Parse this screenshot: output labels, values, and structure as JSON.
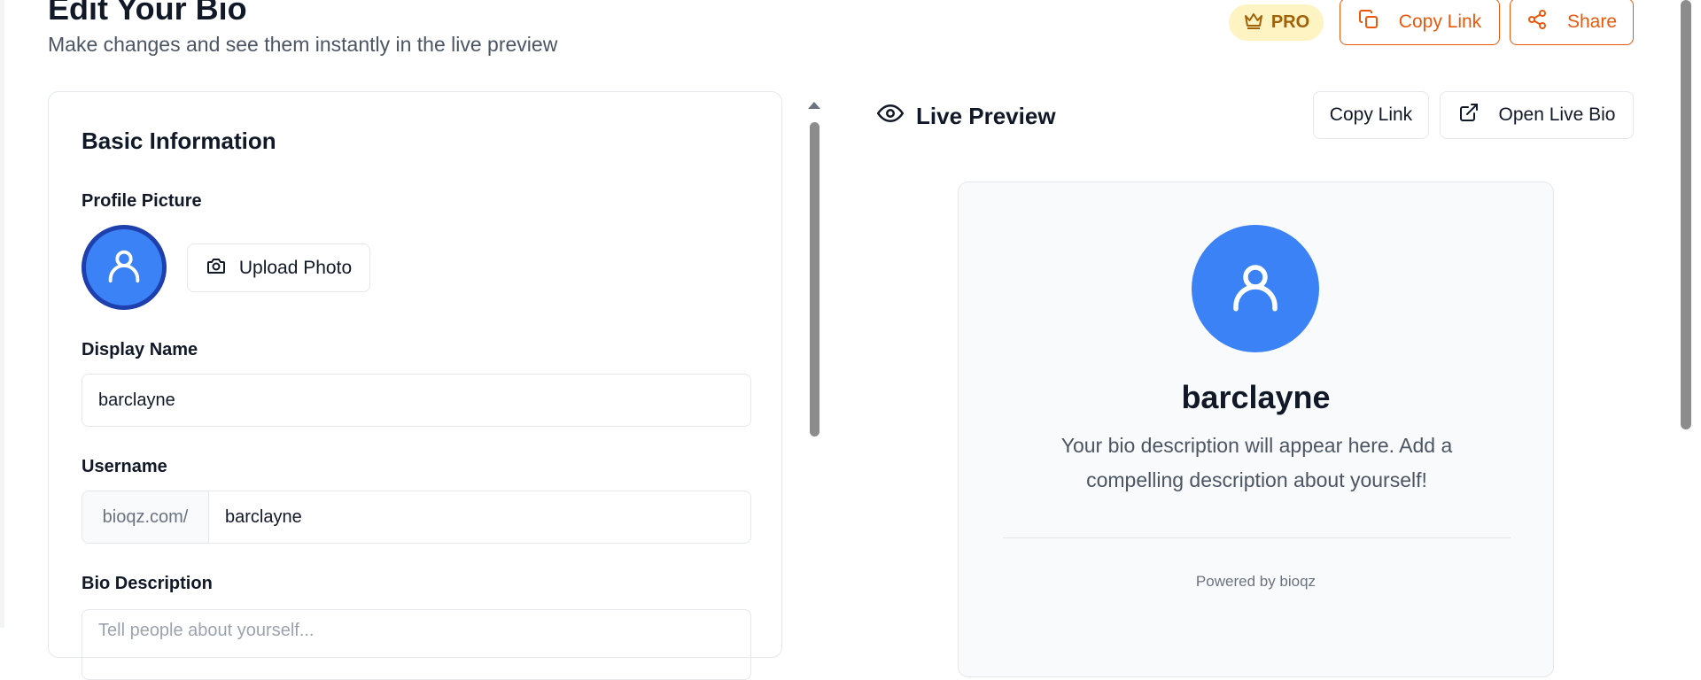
{
  "header": {
    "title": "Edit Your Bio",
    "subtitle": "Make changes and see them instantly in the live preview",
    "pro_label": "PRO",
    "copy_link_label": "Copy Link",
    "share_label": "Share"
  },
  "form": {
    "section_title": "Basic Information",
    "profile_picture_label": "Profile Picture",
    "upload_label": "Upload Photo",
    "display_name_label": "Display Name",
    "display_name_value": "barclayne",
    "username_label": "Username",
    "username_prefix": "bioqz.com/",
    "username_value": "barclayne",
    "bio_label": "Bio Description",
    "bio_placeholder": "Tell people about yourself..."
  },
  "preview": {
    "title": "Live Preview",
    "copy_link_label": "Copy Link",
    "open_live_label": "Open Live Bio",
    "name": "barclayne",
    "description": "Your bio description will appear here. Add a compelling description about yourself!",
    "powered_by": "Powered by bioqz"
  },
  "colors": {
    "accent": "#ea580c",
    "avatar": "#3b82f6",
    "pro_bg": "#fdf3c3",
    "pro_text": "#a16207"
  },
  "icons": [
    "crown-icon",
    "copy-icon",
    "share-icon",
    "user-icon",
    "camera-icon",
    "eye-icon",
    "external-link-icon"
  ]
}
